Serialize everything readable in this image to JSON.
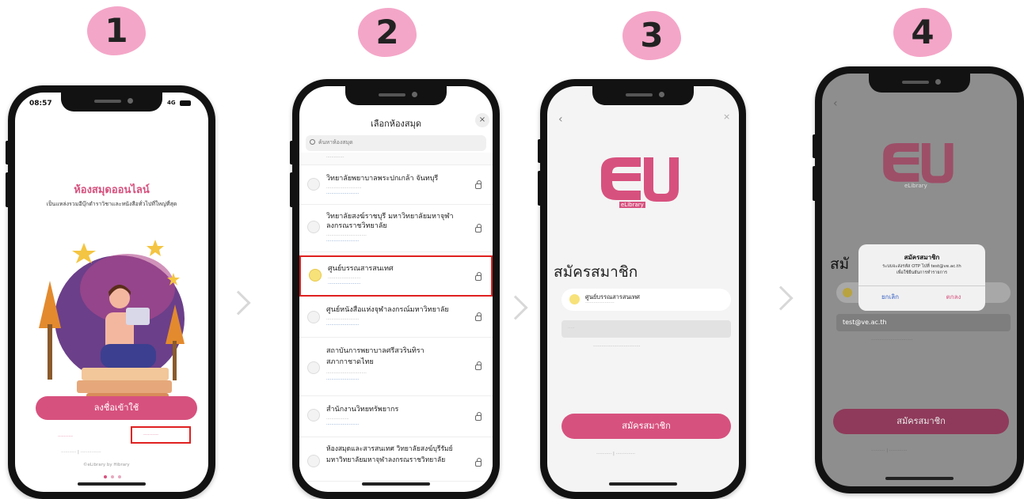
{
  "steps": [
    "1",
    "2",
    "3",
    "4"
  ],
  "s1": {
    "time": "08:57",
    "signal": "4G",
    "title": "ห้องสมุดออนไลน์",
    "subtitle": "เป็นแหล่งรวมอีบุ๊กตำราวิชาและหนังสือทั่วไปที่ใหญ่ที่สุด",
    "login_label": "ลงชื่อเข้าใช้",
    "credit": "©eLibrary by Hibrary"
  },
  "s2": {
    "header": "เลือกห้องสมุด",
    "search_placeholder": "ค้นหาห้องสมุด",
    "items": [
      {
        "title": "วิทยาลัยพยาบาลพระปกเกล้า จันทบุรี"
      },
      {
        "title": "วิทยาลัยสงฆ์ราชบุรี มหาวิทยาลัยมหาจุฬา",
        "title2": "ลงกรณราชวิทยาลัย"
      },
      {
        "title": "ศูนย์บรรณสารสนเทศ"
      },
      {
        "title": "ศูนย์หนังสือแห่งจุฬาลงกรณ์มหาวิทยาลัย"
      },
      {
        "title": "สถาบันการพยาบาลศรีสวรินทิรา",
        "title2": "สภากาชาดไทย"
      },
      {
        "title": "สำนักงานวิทยทรัพยากร"
      },
      {
        "title": "ห้องสมุดและสารสนเทศ วิทยาลัยสงฆ์บุรีรัมย์",
        "title2": "มหาวิทยาลัยมหาจุฬาลงกรณราชวิทยาลัย"
      }
    ]
  },
  "s3": {
    "logo_caption": "eLibrary",
    "heading": "สมัครสมาชิก",
    "library_name": "ศูนย์บรรณสารสนเทศ",
    "register_label": "สมัครสมาชิก"
  },
  "s4": {
    "logo_caption": "eLibrary",
    "heading_partial": "สมั",
    "dialog_title": "สมัครสมาชิก",
    "dialog_line1": "ระบบจะส่งรหัส OTP ไปที่ test@ve.ac.th",
    "dialog_line2": "เพื่อใช้ยืนยันการทำรายการ",
    "cancel_label": "ยกเลิก",
    "ok_label": "ตกลง",
    "email_value": "test@ve.ac.th",
    "register_label": "สมัครสมาชิก"
  },
  "colors": {
    "accent": "#d7517e",
    "blob": "#f4a6c8",
    "highlight": "#e02020",
    "link": "#3b63c4"
  }
}
